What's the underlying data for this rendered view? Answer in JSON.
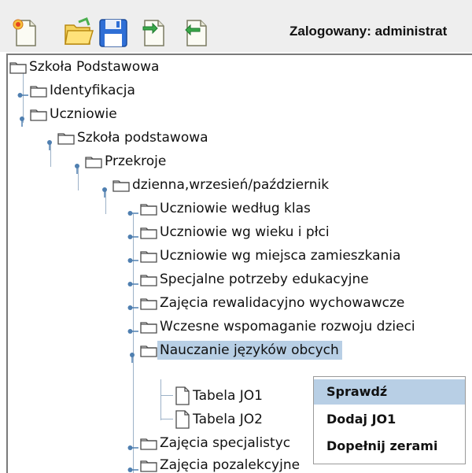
{
  "toolbar": {
    "buttons": [
      {
        "icon": "new-document-icon"
      },
      {
        "icon": "open-folder-icon"
      },
      {
        "icon": "save-disk-icon"
      },
      {
        "icon": "import-document-icon"
      },
      {
        "icon": "export-document-icon"
      }
    ],
    "login_text": "Zalogowany: administrat"
  },
  "tree": {
    "root": "Szkoła Podstawowa",
    "identyfikacja": "Identyfikacja",
    "uczniowie": "Uczniowie",
    "szkola_podstawowa": "Szkoła podstawowa",
    "przekroje": "Przekroje",
    "dzienna": "dzienna,wrzesień/październik",
    "wg_klas": "Uczniowie według klas",
    "wg_wieku": "Uczniowie wg wieku i płci",
    "wg_miejsca": "Uczniowie wg miejsca zamieszkania",
    "specjalne": "Specjalne potrzeby edukacyjne",
    "rewalidacyjno": "Zajęcia rewalidacyjno wychowawcze",
    "wczesne": "Wczesne wspomaganie rozwoju dzieci",
    "nauczanie": "Nauczanie języków obcych",
    "tabela_jo1": "Tabela JO1",
    "tabela_jo2": "Tabela JO2",
    "specjalistyczne": "Zajęcia specjalistyc",
    "pozalekcyjne": "Zajęcia pozalekcyjne"
  },
  "context_menu": {
    "items": [
      "Sprawdź",
      "Dodaj JO1",
      "Dopełnij zerami"
    ],
    "active_index": 0
  },
  "colors": {
    "selection": "#b8cfe5",
    "tree_lines": "#9db2c8",
    "folder_outline": "#4a4a4a"
  }
}
